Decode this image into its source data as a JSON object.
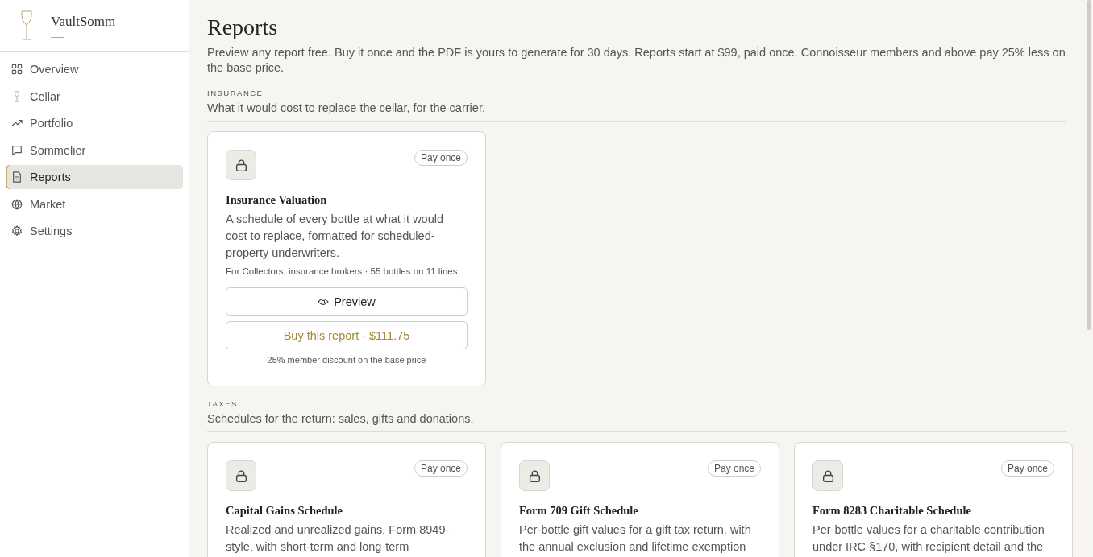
{
  "brand": {
    "name": "VaultSomm"
  },
  "sidebar": {
    "items": [
      {
        "label": "Overview",
        "selected": false
      },
      {
        "label": "Cellar",
        "selected": false
      },
      {
        "label": "Portfolio",
        "selected": false
      },
      {
        "label": "Sommelier",
        "selected": false
      },
      {
        "label": "Reports",
        "selected": true
      },
      {
        "label": "Market",
        "selected": false
      },
      {
        "label": "Settings",
        "selected": false
      }
    ]
  },
  "page": {
    "title": "Reports",
    "intro": "Preview any report free. Buy it once and the PDF is yours to generate for 30 days. Reports start at $99, paid once. Connoisseur members and above pay 25% less on the base price."
  },
  "sections": [
    {
      "label": "INSURANCE",
      "subtitle": "What it would cost to replace the cellar, for the carrier.",
      "reports": [
        {
          "title": "Insurance Valuation",
          "badge": "Pay once",
          "description": "A schedule of every bottle at what it would cost to replace, formatted for scheduled-property underwriters.",
          "meta": "For Collectors, insurance brokers · 55 bottles on 11 lines",
          "preview_label": "Preview",
          "buy_label": "Buy this report · $111.75",
          "note": "25% member discount on the base price"
        }
      ]
    },
    {
      "label": "TAXES",
      "subtitle": "Schedules for the return: sales, gifts and donations.",
      "reports": [
        {
          "title": "Capital Gains Schedule",
          "badge": "Pay once",
          "description": "Realized and unrealized gains, Form 8949-style, with short-term and long-term"
        },
        {
          "title": "Form 709 Gift Schedule",
          "badge": "Pay once",
          "description": "Per-bottle gift values for a gift tax return, with the annual exclusion and lifetime exemption"
        },
        {
          "title": "Form 8283 Charitable Schedule",
          "badge": "Pay once",
          "description": "Per-bottle values for a charitable contribution under IRC §170, with recipient detail and the"
        }
      ]
    }
  ]
}
